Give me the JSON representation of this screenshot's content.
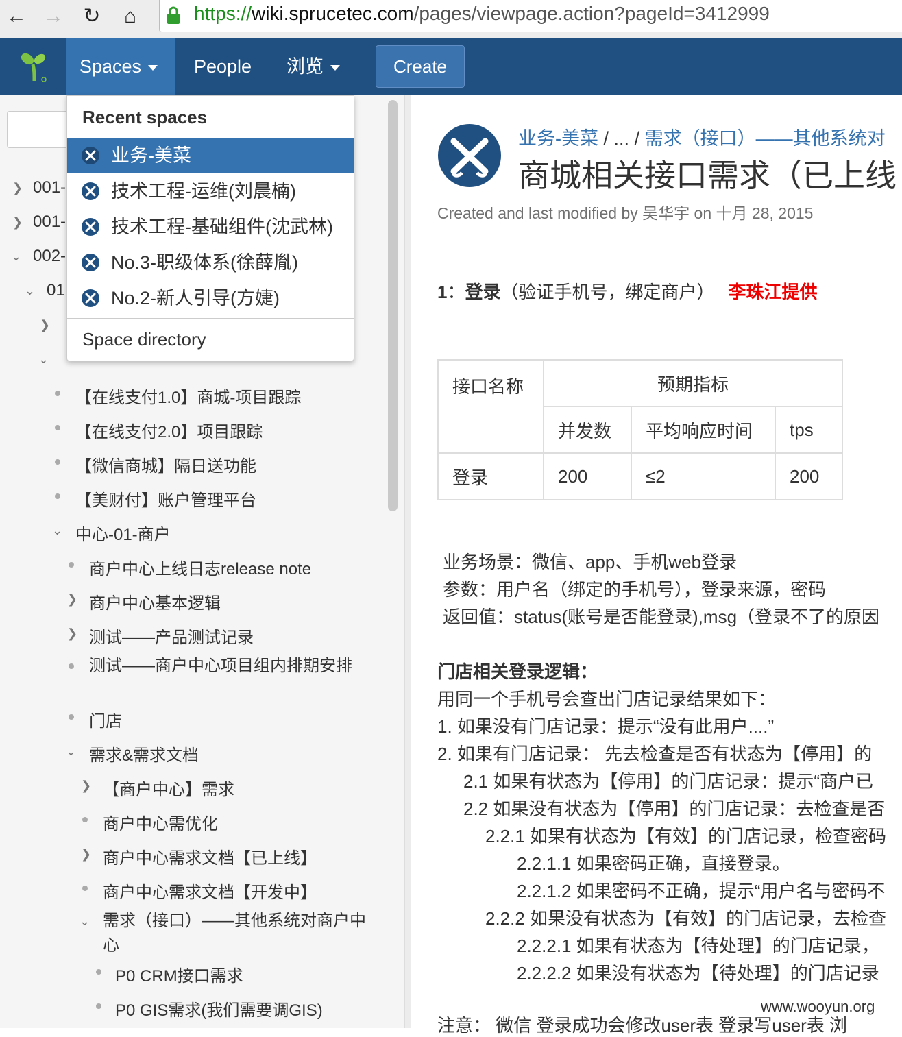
{
  "browser": {
    "url_scheme": "https://",
    "url_host": "wiki.sprucetec.com",
    "url_path": "/pages/viewpage.action?pageId=3412999",
    "back_icon": "arrow-left",
    "forward_icon": "arrow-right",
    "reload_icon": "reload",
    "home_icon": "home",
    "lock_icon": "lock"
  },
  "header": {
    "spaces_label": "Spaces",
    "people_label": "People",
    "browse_label": "浏览",
    "create_label": "Create",
    "brand_color": "#205081",
    "accent_color": "#3572b0"
  },
  "spaces_menu": {
    "heading": "Recent spaces",
    "items": [
      {
        "label": "业务-美菜",
        "active": true
      },
      {
        "label": "技术工程-运维(刘晨楠)",
        "active": false
      },
      {
        "label": "技术工程-基础组件(沈武林)",
        "active": false
      },
      {
        "label": "No.3-职级体系(徐薛胤)",
        "active": false
      },
      {
        "label": "No.2-新人引导(方婕)",
        "active": false
      }
    ],
    "directory_label": "Space directory"
  },
  "sidebar": {
    "tree": [
      {
        "label": "001-"
      },
      {
        "label": "001-"
      },
      {
        "label": "002-"
      },
      {
        "label": "01"
      },
      {
        "label": "【在线支付1.0】商城-项目跟踪"
      },
      {
        "label": "【在线支付2.0】项目跟踪"
      },
      {
        "label": "【微信商城】隔日送功能"
      },
      {
        "label": "【美财付】账户管理平台"
      },
      {
        "label": "中心-01-商户"
      },
      {
        "label": "商户中心上线日志release note"
      },
      {
        "label": "商户中心基本逻辑"
      },
      {
        "label": "测试——产品测试记录"
      },
      {
        "label": "测试——商户中心项目组内排期安排"
      },
      {
        "label": "门店"
      },
      {
        "label": "需求&需求文档"
      },
      {
        "label": "【商户中心】需求"
      },
      {
        "label": "商户中心需优化"
      },
      {
        "label": "商户中心需求文档【已上线】"
      },
      {
        "label": "商户中心需求文档【开发中】"
      },
      {
        "label": "需求（接口）——其他系统对商户中心"
      },
      {
        "label": "P0 CRM接口需求"
      },
      {
        "label": "P0 GIS需求(我们需要调GIS)"
      }
    ]
  },
  "page": {
    "breadcrumb": [
      "业务-美菜",
      "...",
      "需求（接口）——其他系统对"
    ],
    "breadcrumb_sep": "/",
    "title": "商城相关接口需求（已上线",
    "meta": "Created and last modified by 吴华宇 on 十月 28, 2015",
    "section1": {
      "number": "1",
      "bold": "登录",
      "rest": "（验证手机号，绑定商户）",
      "provider": "李珠江提供"
    },
    "table": {
      "h_name": "接口名称",
      "h_expected": "预期指标",
      "h_concurrency": "并发数",
      "h_avg_time": "平均响应时间",
      "h_tps": "tps",
      "row": {
        "name": "登录",
        "concurrency": "200",
        "avg_time": "≤2",
        "tps": "200"
      }
    },
    "details": [
      "业务场景：微信、app、手机web登录",
      "参数：用户名（绑定的手机号），登录来源，密码",
      "返回值：status(账号是否能登录),msg（登录不了的原因"
    ],
    "logic_heading": "门店相关登录逻辑：",
    "logic_lines": [
      "用同一个手机号会查出门店记录结果如下：",
      "1. 如果没有门店记录：提示“没有此用户....”",
      "2. 如果有门店记录： 先去检查是否有状态为【停用】的",
      "2.1 如果有状态为【停用】的门店记录：提示“商户已",
      "2.2 如果没有状态为【停用】的门店记录：去检查是否",
      "2.2.1 如果有状态为【有效】的门店记录，检查密码",
      "2.2.1.1 如果密码正确，直接登录。",
      "2.2.1.2 如果密码不正确，提示“用户名与密码不",
      "2.2.2 如果没有状态为【有效】的门店记录，去检查",
      "2.2.2.1 如果有状态为【待处理】的门店记录，",
      "2.2.2.2 如果没有状态为【待处理】的门店记录"
    ],
    "note_line": "注意： 微信 登录成功会修改user表 登录写user表 浏"
  },
  "watermark": "www.wooyun.org"
}
